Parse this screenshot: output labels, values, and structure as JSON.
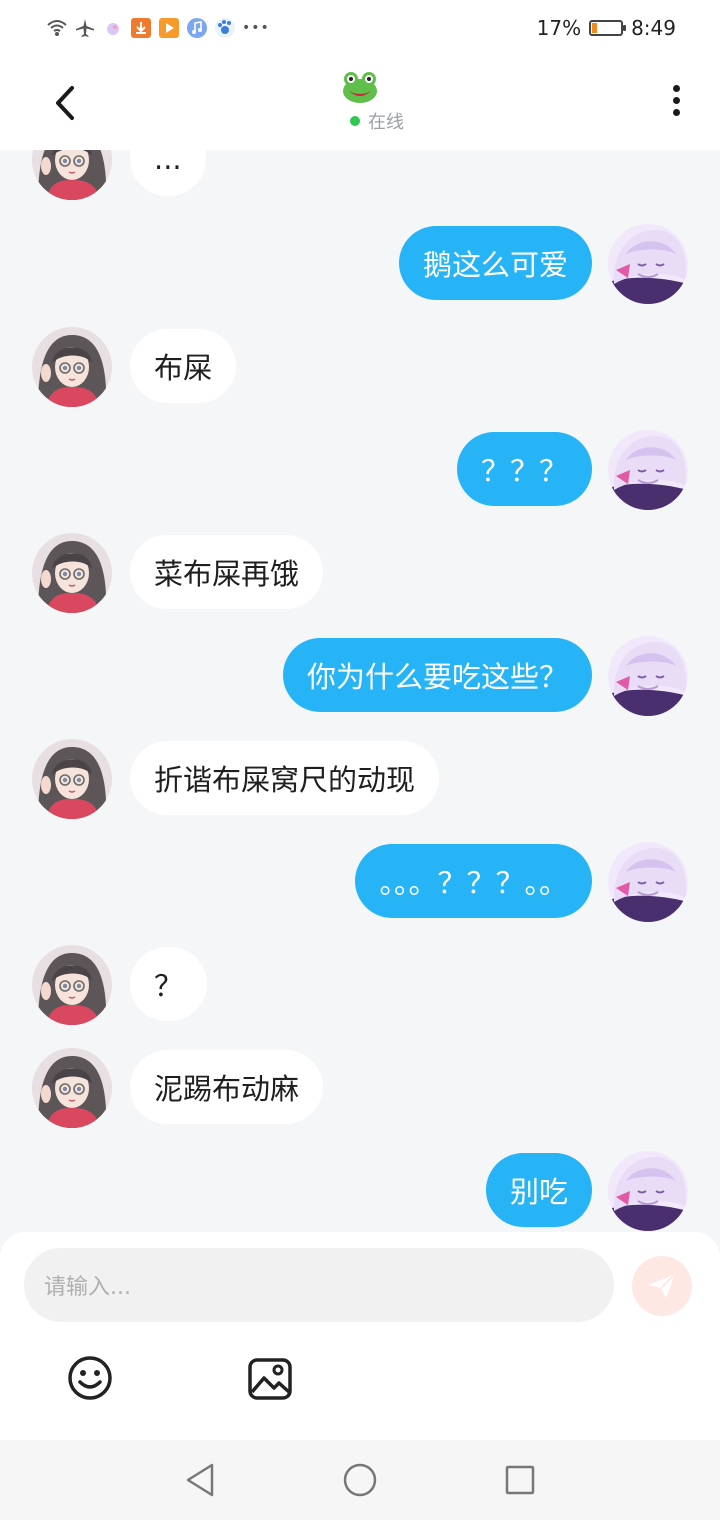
{
  "status_bar": {
    "battery_percent": "17%",
    "battery_level": 0.17,
    "time": "8:49",
    "overflow_icon": "•••",
    "icons": [
      "wifi-icon",
      "airplane-icon",
      "bubble-app-icon",
      "download-app-icon",
      "video-app-icon",
      "music-app-icon",
      "paw-app-icon",
      "more-notifications-icon",
      "battery-icon"
    ]
  },
  "header": {
    "contact_avatar_icon": "frog-icon",
    "online_status": "在线",
    "online_color": "#2fc84f",
    "back_icon": "chevron-left-icon",
    "more_icon": "more-vertical-icon"
  },
  "messages": [
    {
      "side": "in",
      "text": "..."
    },
    {
      "side": "out",
      "text": "鹅这么可爱"
    },
    {
      "side": "in",
      "text": "布屎"
    },
    {
      "side": "out",
      "text": "？？？"
    },
    {
      "side": "in",
      "text": "菜布屎再饿"
    },
    {
      "side": "out",
      "text": "你为什么要吃这些？"
    },
    {
      "side": "in",
      "text": "折谐布屎窝尺的动现"
    },
    {
      "side": "out",
      "text": "。。。？？？。。"
    },
    {
      "side": "in",
      "text": "？"
    },
    {
      "side": "in",
      "text": "泥踢布动麻"
    },
    {
      "side": "out",
      "text": "别吃"
    }
  ],
  "composer": {
    "placeholder": "请输入...",
    "send_icon": "paper-plane-icon",
    "emoji_icon": "smiley-icon",
    "image_icon": "image-icon"
  },
  "nav": {
    "back_icon": "triangle-back-icon",
    "home_icon": "circle-home-icon",
    "recent_icon": "square-recents-icon"
  },
  "colors": {
    "outgoing_bubble": "#27b4f6",
    "incoming_bubble": "#ffffff",
    "chat_background": "#f4f6f8",
    "send_button": "#fde8e4",
    "battery": "#f08a1c"
  }
}
